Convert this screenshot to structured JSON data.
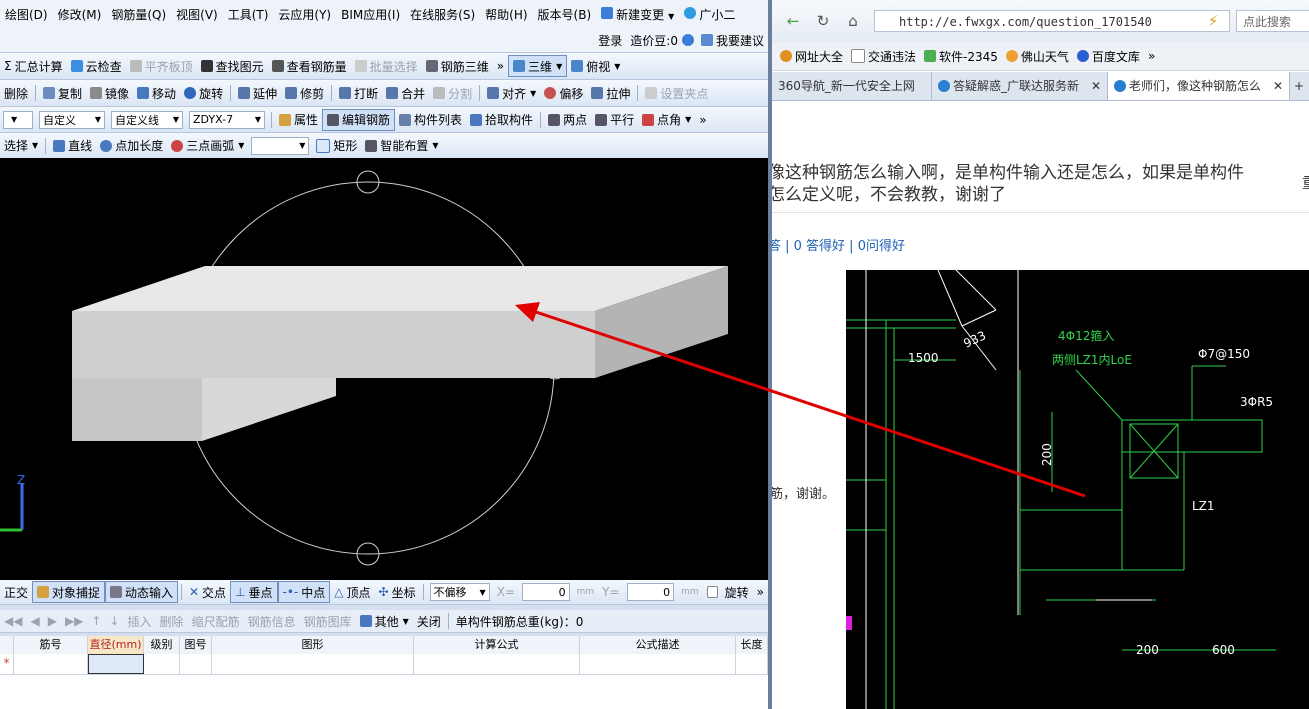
{
  "app": {
    "menu": [
      "绘图(D)",
      "修改(M)",
      "钢筋量(Q)",
      "视图(V)",
      "工具(T)",
      "云应用(Y)",
      "BIM应用(I)",
      "在线服务(S)",
      "帮助(H)",
      "版本号(B)",
      "新建变更",
      "广小二"
    ],
    "menu_right": {
      "login": "登录",
      "price_beans": "造价豆:0",
      "suggest": "我要建议"
    },
    "toolbar1": [
      "汇总计算",
      "云检查",
      "平齐板顶",
      "查找图元",
      "查看钢筋量",
      "批量选择",
      "钢筋三维",
      "三维",
      "俯视"
    ],
    "toolbar2": [
      "删除",
      "复制",
      "镜像",
      "移动",
      "旋转",
      "延伸",
      "修剪",
      "打断",
      "合并",
      "分割",
      "对齐",
      "偏移",
      "拉伸",
      "设置夹点"
    ],
    "toolbar3": {
      "dd1": "",
      "dd2": "自定义",
      "dd3": "自定义线",
      "dd4": "ZDYX-7",
      "items": [
        "属性",
        "编辑钢筋",
        "构件列表",
        "拾取构件",
        "两点",
        "平行",
        "点角"
      ]
    },
    "toolbar4": [
      "选择",
      "直线",
      "点加长度",
      "三点画弧",
      "矩形",
      "智能布置"
    ],
    "status": {
      "items": [
        "正交",
        "对象捕捉",
        "动态输入",
        "交点",
        "垂点",
        "中点",
        "顶点",
        "坐标"
      ],
      "offset": "不偏移",
      "x_label": "X=",
      "x_value": "0",
      "x_unit": "mm",
      "y_label": "Y=",
      "y_value": "0",
      "y_unit": "mm",
      "rotate": "旋转"
    },
    "tablebar": {
      "items": [
        "插入",
        "删除",
        "缩尺配筋",
        "钢筋信息",
        "钢筋图库",
        "其他",
        "关闭"
      ],
      "total": "单构件钢筋总重(kg)：0"
    },
    "columns": [
      "筋号",
      "直径(mm)",
      "级别",
      "图号",
      "图形",
      "计算公式",
      "公式描述",
      "长度"
    ],
    "row_marker": "*"
  },
  "browser": {
    "url": "http://e.fwxgx.com/question_1701540",
    "search_placeholder": "点此搜索",
    "favorites": [
      "网址大全",
      "交通违法",
      "软件-2345",
      "佛山天气",
      "百度文库"
    ],
    "tabs": [
      "360导航_新一代安全上网",
      "答疑解惑_广联达服务新",
      "老师们，像这种钢筋怎么"
    ],
    "question_title": "像这种钢筋怎么输入啊，是单构件输入还是怎么，如果是单构件怎么定义呢，不会教教，谢谢了",
    "question_side": "重",
    "stats": "答 | 0 答得好 | 0问得好",
    "answer_snippet": "筋，谢谢。",
    "cad_labels": {
      "rebar1": "4Φ12箍入",
      "rebar1b": "两侧LZ1内LoE",
      "stirrup": "Φ7@150",
      "rebar2": "3ΦR5",
      "dim1": "1500",
      "dim2": "933",
      "dim3": "200",
      "dim4": "200",
      "dim5": "600",
      "lz": "LZ1"
    }
  }
}
